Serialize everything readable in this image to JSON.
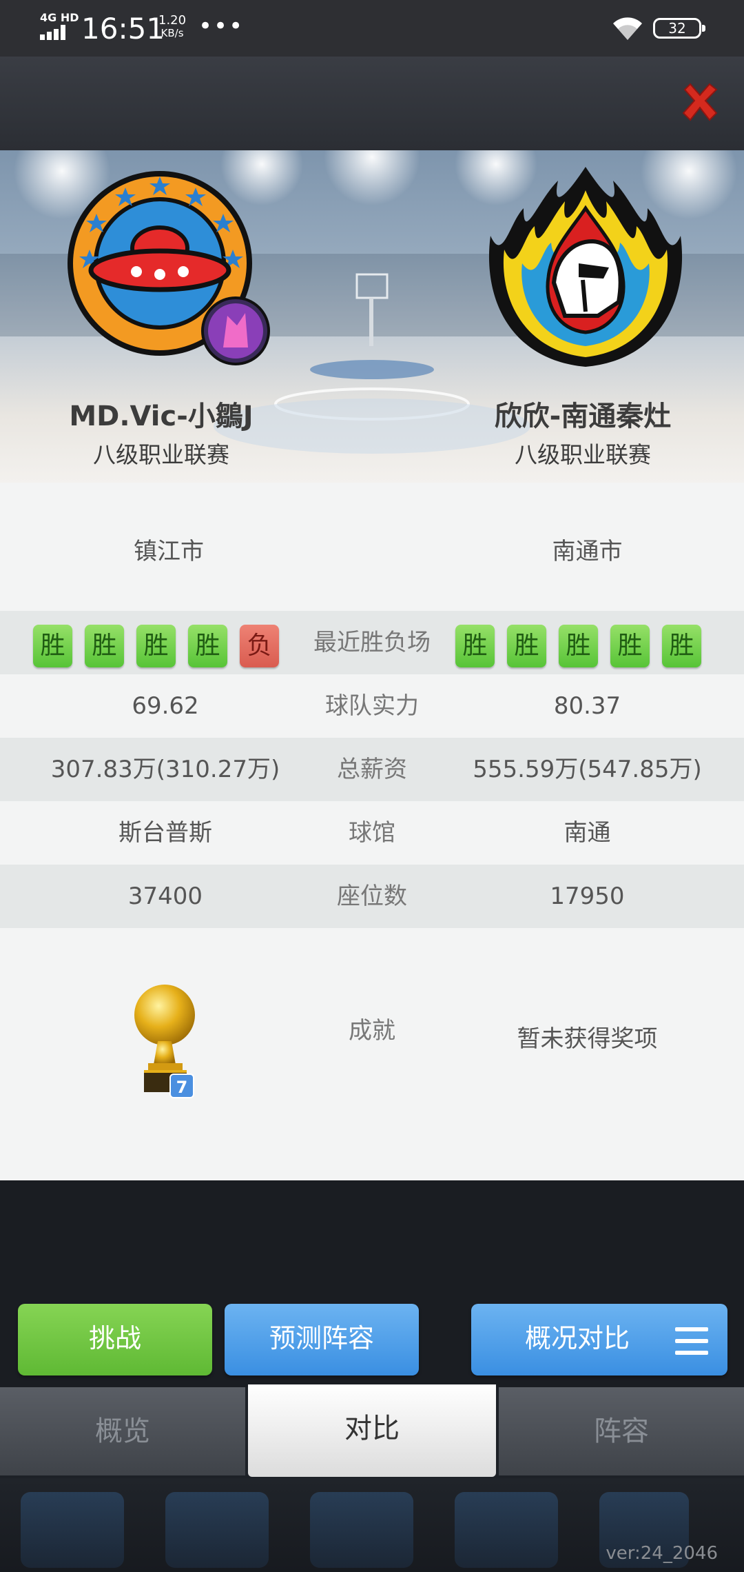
{
  "status_bar": {
    "network": "4G HD",
    "time": "16:51",
    "speed_value": "1.20",
    "speed_unit": "KB/s",
    "battery": "32"
  },
  "teams": {
    "left": {
      "name": "MD.Vic-小鶵J",
      "league": "八级职业联赛",
      "city": "镇江市",
      "recent": [
        "胜",
        "胜",
        "胜",
        "胜",
        "负"
      ],
      "strength": "69.62",
      "salary": "307.83万(310.27万)",
      "arena": "斯台普斯",
      "seats": "37400",
      "trophy_count": "7"
    },
    "right": {
      "name": "欣欣-南通秦灶",
      "league": "八级职业联赛",
      "city": "南通市",
      "recent": [
        "胜",
        "胜",
        "胜",
        "胜",
        "胜"
      ],
      "strength": "80.37",
      "salary": "555.59万(547.85万)",
      "arena": "南通",
      "seats": "17950",
      "achievement": "暂未获得奖项"
    }
  },
  "labels": {
    "recent": "最近胜负场",
    "strength": "球队实力",
    "salary": "总薪资",
    "arena": "球馆",
    "seats": "座位数",
    "achievement": "成就"
  },
  "buttons": {
    "challenge": "挑战",
    "predict_lineup": "预测阵容",
    "overview_compare": "概况对比"
  },
  "tabs": [
    "概览",
    "对比",
    "阵容"
  ],
  "active_tab": "对比",
  "version": "ver:24_2046",
  "colors": {
    "win": "#57c437",
    "loss": "#d95c50",
    "button_green": "#5fb934",
    "button_blue": "#3a8fe2",
    "close_red": "#d42a1e"
  }
}
